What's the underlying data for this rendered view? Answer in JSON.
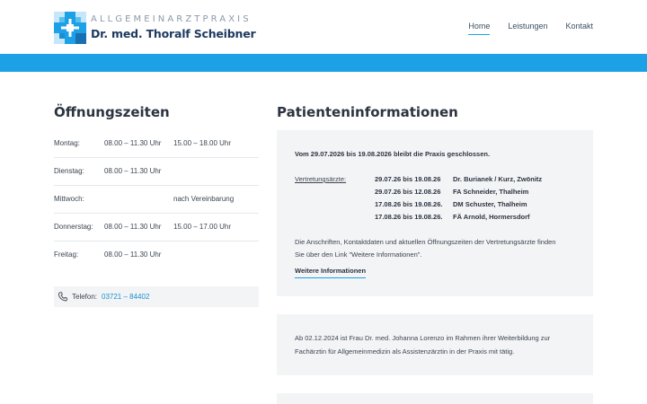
{
  "header": {
    "logo_line1": "ALLGEMEINARZTPRAXIS",
    "logo_line2": "Dr. med. Thoralf Scheibner",
    "nav": [
      {
        "label": "Home",
        "active": true
      },
      {
        "label": "Leistungen",
        "active": false
      },
      {
        "label": "Kontakt",
        "active": false
      }
    ]
  },
  "colors": {
    "accent": "#1ca0e6",
    "card_bg": "#f3f4f6",
    "link": "#1a8fd0"
  },
  "hours": {
    "title": "Öffnungszeiten",
    "rows": [
      {
        "day": "Montag:",
        "t1": "08.00 – 11.30 Uhr",
        "t2": "15.00 – 18.00 Uhr"
      },
      {
        "day": "Dienstag:",
        "t1": "08.00 – 11.30 Uhr",
        "t2": ""
      },
      {
        "day": "Mittwoch:",
        "t1": "",
        "t2": "nach Vereinbarung"
      },
      {
        "day": "Donnerstag:",
        "t1": "08.00 – 11.30 Uhr",
        "t2": "15.00 – 17.00 Uhr"
      },
      {
        "day": "Freitag:",
        "t1": "08.00 – 11.30 Uhr",
        "t2": ""
      }
    ],
    "phone_label": "Telefon:",
    "phone_number": "03721 – 84402"
  },
  "info": {
    "title": "Patienteninformationen",
    "closure": "Vom 29.07.2026 bis 19.08.2026 bleibt die Praxis geschlossen.",
    "deputies_label": "Vertretungsärzte:",
    "deputies": [
      {
        "dates": "29.07.26 bis 19.08.26",
        "name": "Dr. Burianek / Kurz, Zwönitz"
      },
      {
        "dates": "29.07.26 bis 12.08.26",
        "name": "FA Schneider, Thalheim"
      },
      {
        "dates": "17.08.26 bis 19.08.26.",
        "name": "DM Schuster, Thalheim"
      },
      {
        "dates": "17.08.26 bis 19.08.26.",
        "name": "FÄ Arnold, Hormersdorf"
      }
    ],
    "note_line1": "Die Anschriften, Kontaktdaten und aktuellen Öffnungszeiten der Vertretungsärzte finden",
    "note_line2": "Sie über den Link \"Weitere Informationen\".",
    "more_link": "Weitere Informationen",
    "notice_line1": "Ab 02.12.2024 ist Frau Dr. med. Johanna Lorenzo im Rahmen ihrer Weiterbildung zur",
    "notice_line2": "Fachärztin für Allgemeinmedizin als Assistenzärztin in der Praxis mit tätig."
  }
}
